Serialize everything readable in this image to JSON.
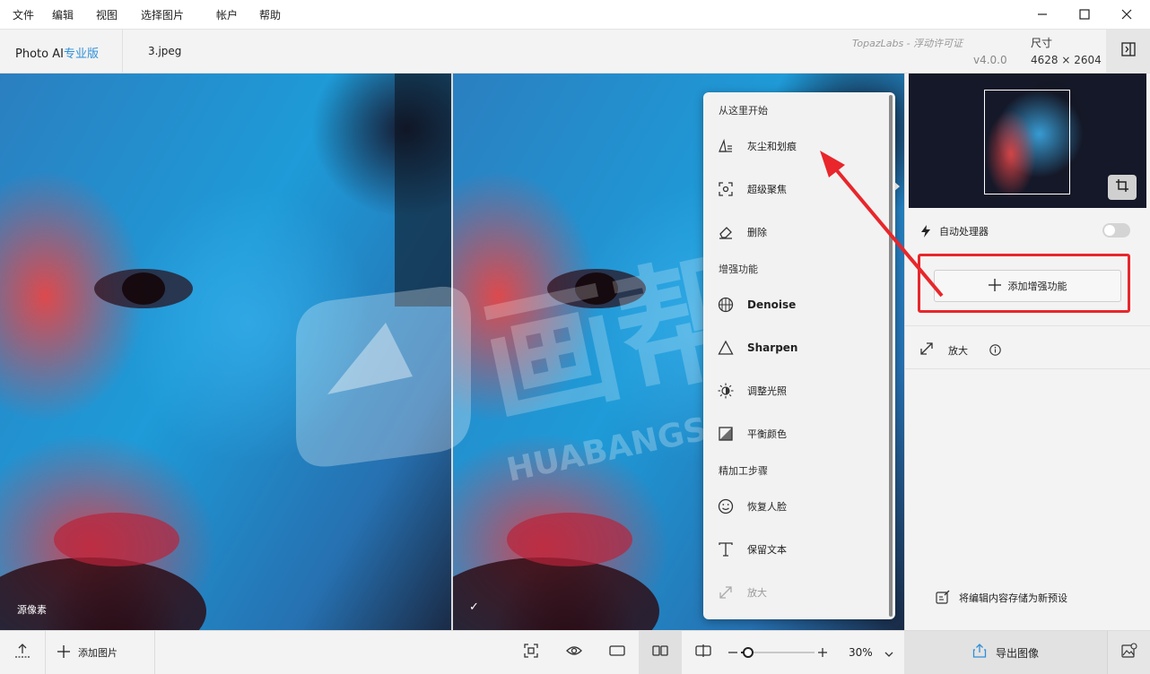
{
  "menubar": {
    "items": [
      "文件",
      "编辑",
      "视图",
      "选择图片",
      "帐户",
      "帮助"
    ]
  },
  "header": {
    "app_name": "Photo AI",
    "app_edition": "专业版",
    "file_name": "3.jpeg",
    "license_text": "TopazLabs - 浮动许可证",
    "version": "v4.0.0",
    "size_label": "尺寸",
    "size_value": "4628 × 2604"
  },
  "main": {
    "left_label": "源像素",
    "right_check": "✓"
  },
  "dropdown": {
    "sections": [
      {
        "title": "从这里开始",
        "items": [
          {
            "label": "灰尘和划痕",
            "icon": "dust-scratch-icon"
          },
          {
            "label": "超级聚焦",
            "icon": "focus-icon"
          },
          {
            "label": "删除",
            "icon": "eraser-icon"
          }
        ]
      },
      {
        "title": "增强功能",
        "items": [
          {
            "label": "Denoise",
            "icon": "denoise-icon"
          },
          {
            "label": "Sharpen",
            "icon": "sharpen-icon"
          },
          {
            "label": "调整光照",
            "icon": "light-icon"
          },
          {
            "label": "平衡颜色",
            "icon": "color-balance-icon"
          }
        ]
      },
      {
        "title": "精加工步骤",
        "items": [
          {
            "label": "恢复人脸",
            "icon": "face-icon"
          },
          {
            "label": "保留文本",
            "icon": "text-icon"
          },
          {
            "label": "放大",
            "icon": "upscale-icon"
          }
        ]
      }
    ]
  },
  "right": {
    "autopilot_label": "自动处理器",
    "add_enhancement_label": "添加增强功能",
    "upscale_label": "放大",
    "save_preset_label": "将编辑内容存储为新预设"
  },
  "bottom": {
    "add_image_label": "添加图片",
    "zoom_value": "30%",
    "export_label": "导出图像",
    "zoom_level": 0.1
  },
  "watermark": {
    "text_cn": "画帮手",
    "text_en": "HUABANGSHOU.COM"
  },
  "colors": {
    "annotation_red": "#e8262b",
    "accent_blue": "#2f8fd8"
  }
}
